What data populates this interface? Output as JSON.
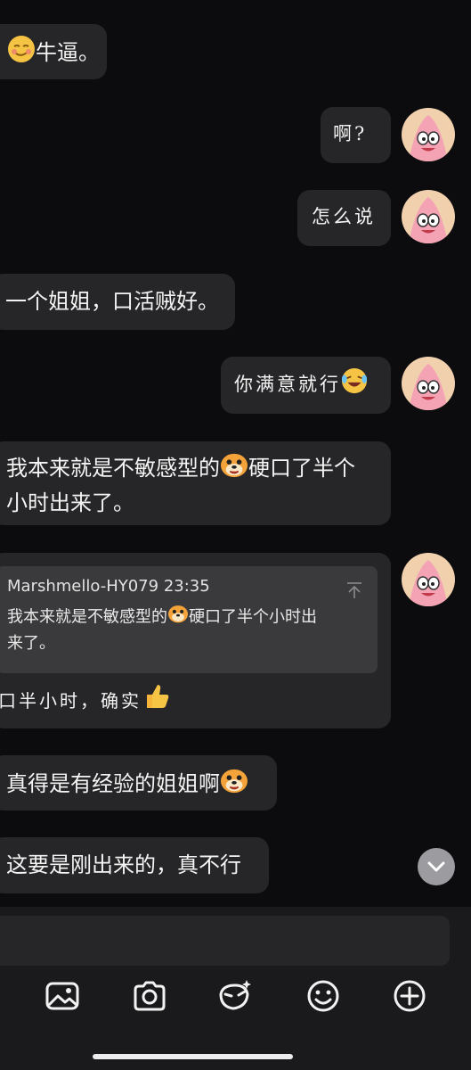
{
  "messages": [
    {
      "id": "m1",
      "side": "left",
      "text": "牛逼。",
      "emoji_before": "smirk-emoji"
    },
    {
      "id": "m2",
      "side": "right",
      "text": "啊?"
    },
    {
      "id": "m3",
      "side": "right",
      "text": "怎么说"
    },
    {
      "id": "m4",
      "side": "left",
      "text": "一个姐姐，口活贼好。"
    },
    {
      "id": "m5",
      "side": "right",
      "text": "你满意就行",
      "emoji_after": "laughing-tears-emoji"
    },
    {
      "id": "m6",
      "side": "left",
      "line1_a": "我本来就是不敏感型的",
      "line1_b": "硬口了半个",
      "line2": "小时出来了。",
      "emoji_mid": "dog-face-emoji"
    },
    {
      "id": "m7",
      "side": "right",
      "quote": {
        "sender": "Marshmello-HY079",
        "time": "23:35",
        "line1_a": "我本来就是不敏感型的",
        "line1_b": "硬口了半个小时出",
        "line2": "来了。"
      },
      "text": "口半小时，确实",
      "emoji_after": "thumbs-up-emoji"
    },
    {
      "id": "m8",
      "side": "left",
      "text": "真得是有经验的姐姐啊",
      "emoji_after": "dog-face-emoji"
    },
    {
      "id": "m9",
      "side": "left",
      "text": "这要是刚出来的，真不行"
    }
  ],
  "toolbar": {
    "icons": [
      "image-icon",
      "camera-icon",
      "sticker-icon",
      "emoji-icon",
      "plus-icon"
    ]
  },
  "colors": {
    "background": "#0c0c0e",
    "bubble": "#262628",
    "quote": "#3a3a3c",
    "avatar": "#f1d0ae"
  }
}
